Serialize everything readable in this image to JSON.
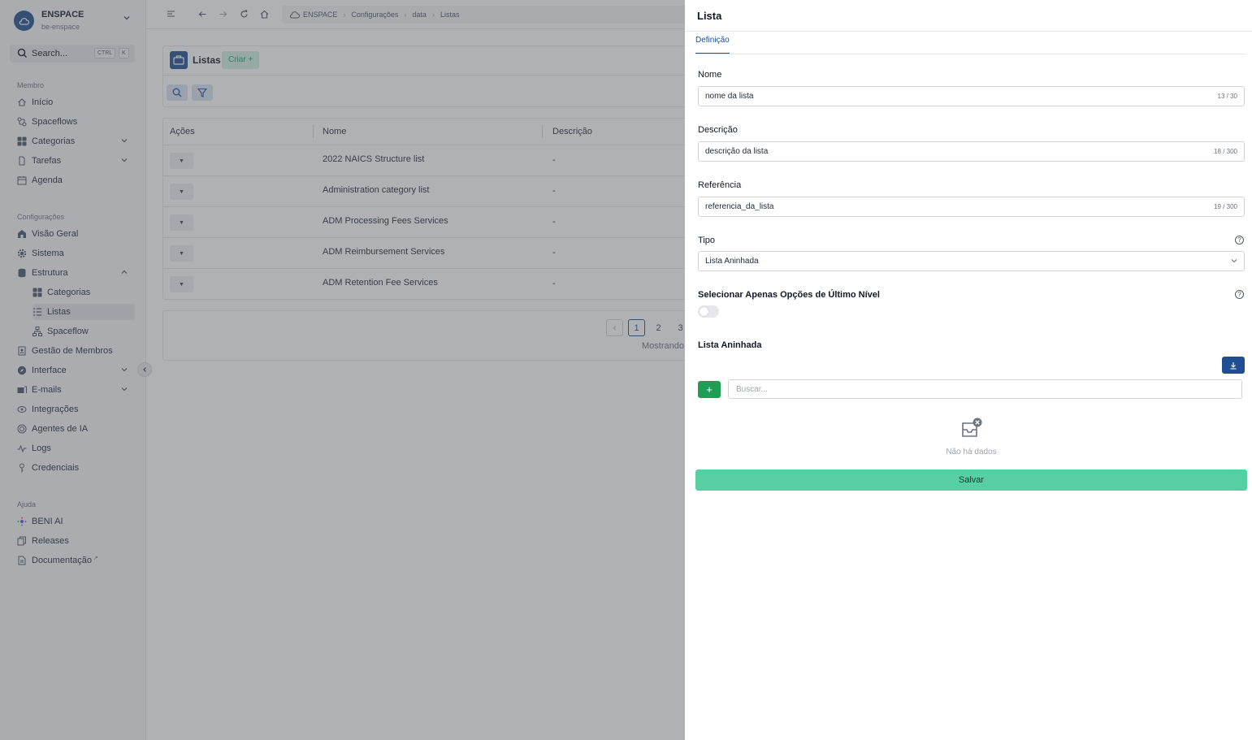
{
  "workspace": {
    "name": "ENSPACE",
    "slug": "be-enspace"
  },
  "search": {
    "label": "Search...",
    "kbd1": "CTRL",
    "kbd2": "K"
  },
  "sidebar": {
    "member_label": "Membro",
    "member_items": [
      {
        "label": "Início",
        "icon": "home-icon"
      },
      {
        "label": "Spaceflows",
        "icon": "spaceflows-icon"
      },
      {
        "label": "Categorias",
        "icon": "grid-icon"
      },
      {
        "label": "Tarefas",
        "icon": "task-icon"
      },
      {
        "label": "Agenda",
        "icon": "calendar-icon"
      }
    ],
    "config_label": "Configurações",
    "config_items": [
      {
        "label": "Visão Geral",
        "icon": "building-icon"
      },
      {
        "label": "Sistema",
        "icon": "gear-icon"
      },
      {
        "label": "Estrutura",
        "icon": "database-icon"
      }
    ],
    "structure_items": [
      {
        "label": "Categorias",
        "icon": "grid-icon"
      },
      {
        "label": "Listas",
        "icon": "list-icon"
      },
      {
        "label": "Spaceflow",
        "icon": "flow-icon"
      }
    ],
    "config_items2": [
      {
        "label": "Gestão de Membros",
        "icon": "members-icon"
      },
      {
        "label": "Interface",
        "icon": "compass-icon"
      },
      {
        "label": "E-mails",
        "icon": "mail-icon"
      },
      {
        "label": "Integrações",
        "icon": "integrations-icon"
      },
      {
        "label": "Agentes de IA",
        "icon": "ai-agent-icon"
      },
      {
        "label": "Logs",
        "icon": "pulse-icon"
      },
      {
        "label": "Credenciais",
        "icon": "key-icon"
      }
    ],
    "help_label": "Ajuda",
    "help_items": [
      {
        "label": "BENI AI",
        "icon": "beni-icon"
      },
      {
        "label": "Releases",
        "icon": "releases-icon"
      },
      {
        "label": "Documentação",
        "icon": "doc-icon"
      }
    ]
  },
  "breadcrumbs": [
    "ENSPACE",
    "Configurações",
    "data",
    "Listas"
  ],
  "lists_card": {
    "title": "Listas",
    "create_label": "Criar +"
  },
  "table": {
    "headers": [
      "Ações",
      "Nome",
      "Descrição"
    ],
    "rows": [
      {
        "name": "2022 NAICS Structure list",
        "description": "-"
      },
      {
        "name": "Administration category list",
        "description": "-"
      },
      {
        "name": "ADM Processing Fees Services",
        "description": "-"
      },
      {
        "name": "ADM Reimbursement Services",
        "description": "-"
      },
      {
        "name": "ADM Retention Fee Services",
        "description": "-"
      }
    ]
  },
  "pagination": {
    "pages": [
      "1",
      "2",
      "3"
    ],
    "current": "1",
    "showing": "Mostrando"
  },
  "drawer": {
    "title": "Lista",
    "tab": "Definição",
    "name_label": "Nome",
    "name_value": "nome da lista",
    "name_count": "13 / 30",
    "desc_label": "Descrição",
    "desc_value": "descrição da lista",
    "desc_count": "18 / 300",
    "ref_label": "Referência",
    "ref_value": "referencia_da_lista",
    "ref_count": "19 / 300",
    "type_label": "Tipo",
    "type_value": "Lista Aninhada",
    "last_level_label": "Selecionar Apenas Opções de Último Nível",
    "last_level_on": false,
    "nested_label": "Lista Aninhada",
    "search_placeholder": "Buscar...",
    "empty_text": "Não há dados",
    "save_label": "Salvar"
  },
  "colors": {
    "primary": "#1f4f91",
    "success": "#1f9d55",
    "save": "#57cfa5"
  }
}
